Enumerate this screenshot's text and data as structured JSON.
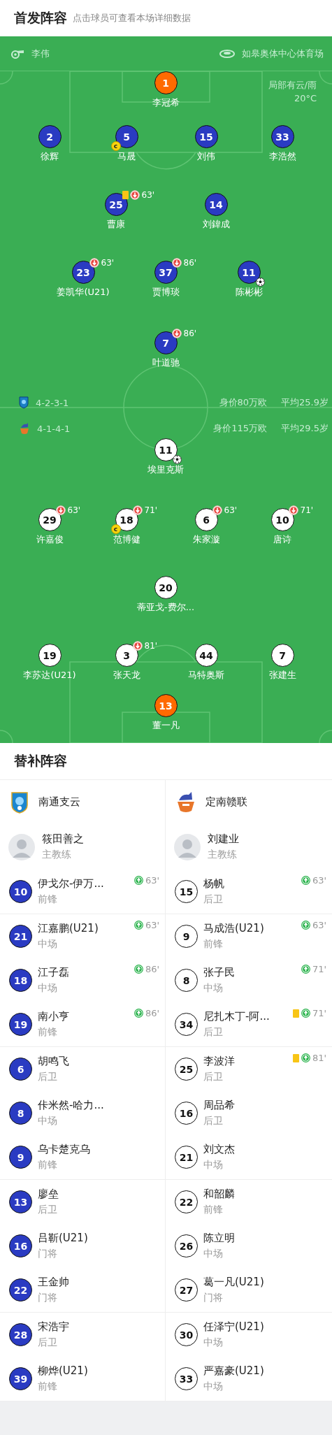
{
  "header": {
    "title": "首发阵容",
    "subtitle": "点击球员可查看本场详细数据"
  },
  "match_info": {
    "referee": "李伟",
    "stadium": "如皋奥体中心体育场",
    "weather": "局部有云/雨",
    "temperature": "20°C"
  },
  "lineups": [
    {
      "color": "#2a3bc2",
      "formation": "4-2-3-1",
      "market_value": "身价80万欧",
      "average_age": "平均25.9岁",
      "rows": [
        [
          {
            "number": "1",
            "name": "李冠希",
            "kind": "goalkeeper",
            "yellow_card": false,
            "goal": false
          }
        ],
        [
          {
            "number": "2",
            "name": "徐辉",
            "kind": "outfield",
            "yellow_card": false,
            "goal": false
          },
          {
            "number": "5",
            "name": "马晟",
            "kind": "outfield",
            "yellow_card": false,
            "goal": false,
            "captain_badge": "c"
          },
          {
            "number": "15",
            "name": "刘伟",
            "kind": "outfield",
            "yellow_card": false,
            "goal": false
          },
          {
            "number": "33",
            "name": "李浩然",
            "kind": "outfield",
            "yellow_card": false,
            "goal": false
          }
        ],
        [
          {
            "number": "25",
            "name": "曹康",
            "kind": "outfield",
            "yellow_card": true,
            "goal": false,
            "sub_off": "63'"
          },
          {
            "number": "14",
            "name": "刘鍏成",
            "kind": "outfield",
            "yellow_card": false,
            "goal": false
          }
        ],
        [
          {
            "number": "23",
            "name": "姜凯华(U21)",
            "kind": "outfield",
            "yellow_card": false,
            "goal": false,
            "sub_off": "63'"
          },
          {
            "number": "37",
            "name": "贾博琰",
            "kind": "outfield",
            "yellow_card": false,
            "goal": false,
            "sub_off": "86'"
          },
          {
            "number": "11",
            "name": "陈彬彬",
            "kind": "outfield",
            "yellow_card": false,
            "goal": true
          }
        ],
        [
          {
            "number": "7",
            "name": "叶道驰",
            "kind": "outfield",
            "yellow_card": false,
            "goal": false,
            "sub_off": "86'"
          }
        ]
      ]
    },
    {
      "color": "#ffffff",
      "formation": "4-1-4-1",
      "market_value": "身价115万欧",
      "average_age": "平均29.5岁",
      "rows": [
        [
          {
            "number": "11",
            "name": "埃里克斯",
            "kind": "outfield",
            "yellow_card": false,
            "goal": true
          }
        ],
        [
          {
            "number": "29",
            "name": "许嘉俊",
            "kind": "outfield",
            "yellow_card": false,
            "goal": false,
            "sub_off": "63'"
          },
          {
            "number": "18",
            "name": "范博健",
            "kind": "outfield",
            "yellow_card": false,
            "goal": false,
            "sub_off": "71'",
            "captain_badge": "c"
          },
          {
            "number": "6",
            "name": "朱家漩",
            "kind": "outfield",
            "yellow_card": false,
            "goal": false,
            "sub_off": "63'"
          },
          {
            "number": "10",
            "name": "唐诗",
            "kind": "outfield",
            "yellow_card": false,
            "goal": false,
            "sub_off": "71'"
          }
        ],
        [
          {
            "number": "20",
            "name": "蒂亚戈-费尔...",
            "kind": "outfield",
            "yellow_card": false,
            "goal": false
          }
        ],
        [
          {
            "number": "19",
            "name": "李苏达(U21)",
            "kind": "outfield",
            "yellow_card": false,
            "goal": false
          },
          {
            "number": "3",
            "name": "张天龙",
            "kind": "outfield",
            "yellow_card": false,
            "goal": false,
            "sub_off": "81'"
          },
          {
            "number": "44",
            "name": "马特奥斯",
            "kind": "outfield",
            "yellow_card": false,
            "goal": false
          },
          {
            "number": "7",
            "name": "张建生",
            "kind": "outfield",
            "yellow_card": false,
            "goal": false
          }
        ],
        [
          {
            "number": "13",
            "name": "董一凡",
            "kind": "goalkeeper",
            "yellow_card": false,
            "goal": false
          }
        ]
      ]
    }
  ],
  "bench": {
    "title": "替补阵容",
    "teams": [
      {
        "name": "南通支云",
        "coach": "筱田善之",
        "coach_role": "主教练"
      },
      {
        "name": "定南赣联",
        "coach": "刘建业",
        "coach_role": "主教练"
      }
    ],
    "groups": [
      [
        {
          "home": {
            "number": "10",
            "name": "伊戈尔-伊万...",
            "position": "前锋",
            "yellow_card": false,
            "sub_on": "63'"
          },
          "away": {
            "number": "15",
            "name": "杨帆",
            "position": "后卫",
            "yellow_card": false,
            "sub_on": "63'"
          }
        }
      ],
      [
        {
          "home": {
            "number": "21",
            "name": "江嘉鹏(U21)",
            "position": "中场",
            "yellow_card": false,
            "sub_on": "63'"
          },
          "away": {
            "number": "9",
            "name": "马成浩(U21)",
            "position": "前锋",
            "yellow_card": false,
            "sub_on": "63'"
          }
        },
        {
          "home": {
            "number": "18",
            "name": "江子磊",
            "position": "中场",
            "yellow_card": false,
            "sub_on": "86'"
          },
          "away": {
            "number": "8",
            "name": "张子民",
            "position": "中场",
            "yellow_card": false,
            "sub_on": "71'"
          }
        },
        {
          "home": {
            "number": "19",
            "name": "南小亨",
            "position": "前锋",
            "yellow_card": false,
            "sub_on": "86'"
          },
          "away": {
            "number": "34",
            "name": "尼扎木丁-阿...",
            "position": "后卫",
            "yellow_card": true,
            "sub_on": "71'"
          }
        }
      ],
      [
        {
          "home": {
            "number": "6",
            "name": "胡鸣飞",
            "position": "后卫",
            "yellow_card": false
          },
          "away": {
            "number": "25",
            "name": "李波洋",
            "position": "后卫",
            "yellow_card": true,
            "sub_on": "81'"
          }
        },
        {
          "home": {
            "number": "8",
            "name": "佧米然-哈力...",
            "position": "中场",
            "yellow_card": false
          },
          "away": {
            "number": "16",
            "name": "周品希",
            "position": "后卫",
            "yellow_card": false
          }
        },
        {
          "home": {
            "number": "9",
            "name": "乌卡楚克乌",
            "position": "前锋",
            "yellow_card": false
          },
          "away": {
            "number": "21",
            "name": "刘文杰",
            "position": "中场",
            "yellow_card": false
          }
        }
      ],
      [
        {
          "home": {
            "number": "13",
            "name": "廖垒",
            "position": "后卫",
            "yellow_card": false
          },
          "away": {
            "number": "22",
            "name": "和韶麟",
            "position": "前锋",
            "yellow_card": false
          }
        },
        {
          "home": {
            "number": "16",
            "name": "吕靳(U21)",
            "position": "门将",
            "yellow_card": false
          },
          "away": {
            "number": "26",
            "name": "陈立明",
            "position": "中场",
            "yellow_card": false
          }
        },
        {
          "home": {
            "number": "22",
            "name": "王金帅",
            "position": "门将",
            "yellow_card": false
          },
          "away": {
            "number": "27",
            "name": "葛一凡(U21)",
            "position": "门将",
            "yellow_card": false
          }
        }
      ],
      [
        {
          "home": {
            "number": "28",
            "name": "宋浩宇",
            "position": "后卫",
            "yellow_card": false
          },
          "away": {
            "number": "30",
            "name": "任泽宁(U21)",
            "position": "中场",
            "yellow_card": false
          }
        },
        {
          "home": {
            "number": "39",
            "name": "柳烨(U21)",
            "position": "前锋",
            "yellow_card": false
          },
          "away": {
            "number": "33",
            "name": "严嘉豪(U21)",
            "position": "中场",
            "yellow_card": false
          }
        }
      ]
    ]
  }
}
